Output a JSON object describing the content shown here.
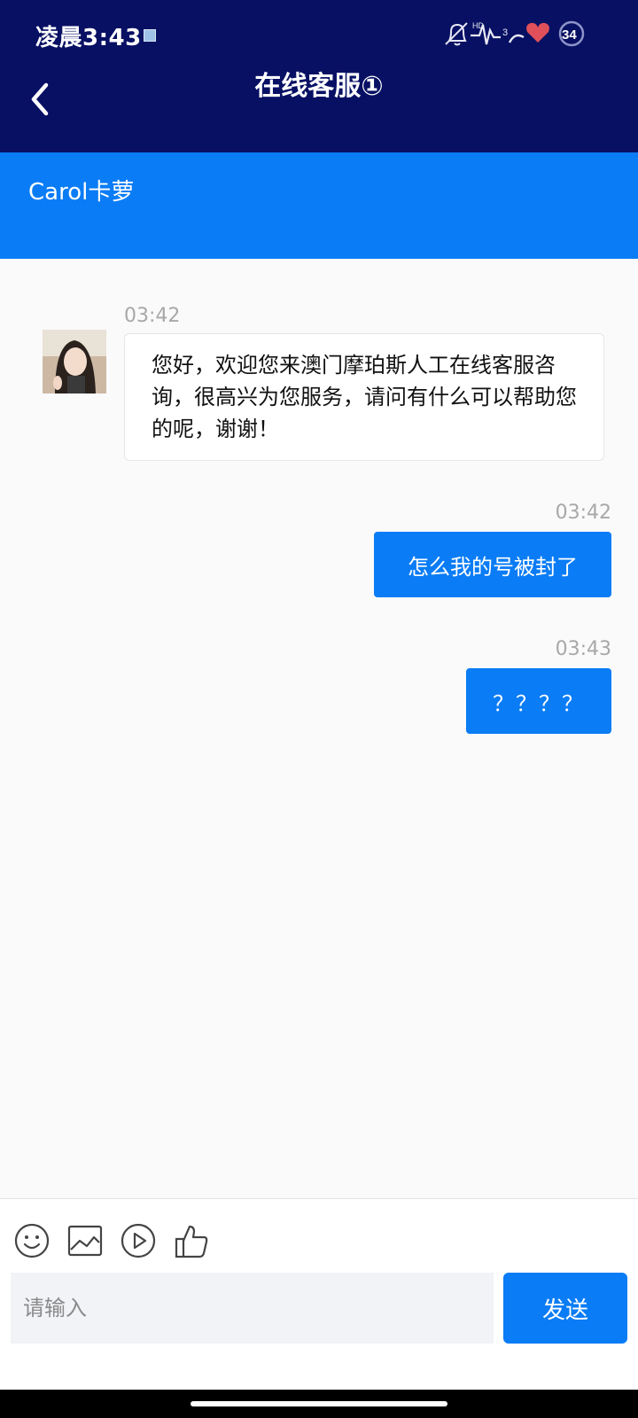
{
  "status_bar": {
    "time": "凌晨3:43",
    "hd_label": "HD",
    "signal_label": "3",
    "battery": "34"
  },
  "header": {
    "title": "在线客服①"
  },
  "agent": {
    "name": "Carol卡萝"
  },
  "messages": [
    {
      "direction": "incoming",
      "time": "03:42",
      "text": "您好，欢迎您来澳门摩珀斯人工在线客服咨询，很高兴为您服务，请问有什么可以帮助您的呢，谢谢！"
    },
    {
      "direction": "outgoing",
      "time": "03:42",
      "text": "怎么我的号被封了"
    },
    {
      "direction": "outgoing",
      "time": "03:43",
      "text": "？？？？"
    }
  ],
  "composer": {
    "placeholder": "请输入",
    "send_label": "发送",
    "tools": [
      "emoji-icon",
      "image-icon",
      "video-icon",
      "thumbs-up-icon"
    ]
  },
  "colors": {
    "header_bg": "#071063",
    "accent": "#0a7cf5",
    "background": "#fafafa"
  }
}
